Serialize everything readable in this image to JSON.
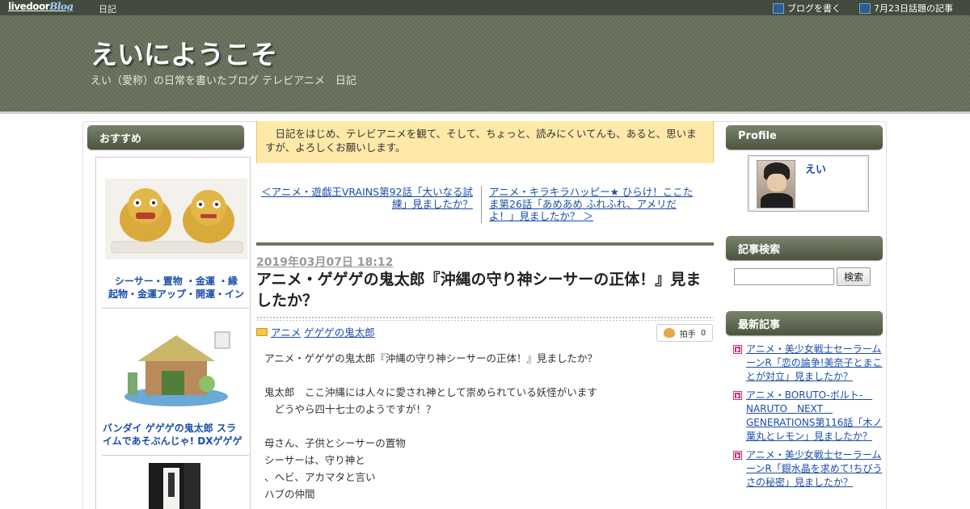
{
  "topbar": {
    "logo_main": "livedoor",
    "logo_blog": "Blog",
    "nav_diary": "日記",
    "write_blog": "ブログを書く",
    "topic_articles": "7月23日話題の記事"
  },
  "header": {
    "title": "えいにようこそ",
    "description": "えい（愛称）の日常を書いたブログ テレビアニメ　日記"
  },
  "left": {
    "heading": "おすすめ",
    "items": [
      {
        "caption_line1": "シーサー・置物 ・金運 ・縁",
        "caption_line2": "起物・金運アップ・開運・イン"
      },
      {
        "caption_line1": "バンダイ ゲゲゲの鬼太郎 スラ",
        "caption_line2": "イムであそぶんじゃ! DXゲゲゲ"
      }
    ]
  },
  "main": {
    "notice": "日記をはじめ、テレビアニメを観て、そして、ちょっと、読みにくいてんも、あると、思いますが、よろしくお願いします。",
    "prev_link": "＜アニメ・遊戯王VRAINS第92話「大いなる試練」見ましたか？",
    "next_link": "アニメ・キラキラハッピー★ ひらけ！ここたま第26話「あめあめ ふれふれ、アメリだよ！」見ましたか？ ＞",
    "date": "2019年03月07日 18:12",
    "title": "アニメ・ゲゲゲの鬼太郎『沖縄の守り神シーサーの正体！』見ましたか？",
    "categories": [
      "アニメ",
      "ゲゲゲの鬼太郎"
    ],
    "clap_label": "拍手",
    "clap_count": "0",
    "body": [
      "アニメ・ゲゲゲの鬼太郎『沖縄の守り神シーサーの正体！』見ましたか？",
      "",
      "鬼太郎　ここ沖縄には人々に愛され神として崇められている妖怪がいます",
      "　どうやら四十七士のようですが！？",
      "",
      "母さん、子供とシーサーの置物",
      "シーサーは、守り神と",
      "、ヘビ、アカマタと言い",
      "ハブの仲間"
    ]
  },
  "right": {
    "profile_heading": "Profile",
    "profile_name": "えい",
    "search_heading": "記事検索",
    "search_button": "検索",
    "search_value": "",
    "recent_heading": "最新記事",
    "recent": [
      "アニメ・美少女戦士セーラームーンR「恋の論争!美奈子とまことが対立」見ましたか？",
      "アニメ・BORUTO-ボルト-　NARUTO　NEXT　GENERATIONS第116話「木ノ葉丸とレモン」見ましたか？",
      "アニメ・美少女戦士セーラームーンR「銀水晶を求めて!ちびうさの秘密」見ましたか？"
    ]
  }
}
